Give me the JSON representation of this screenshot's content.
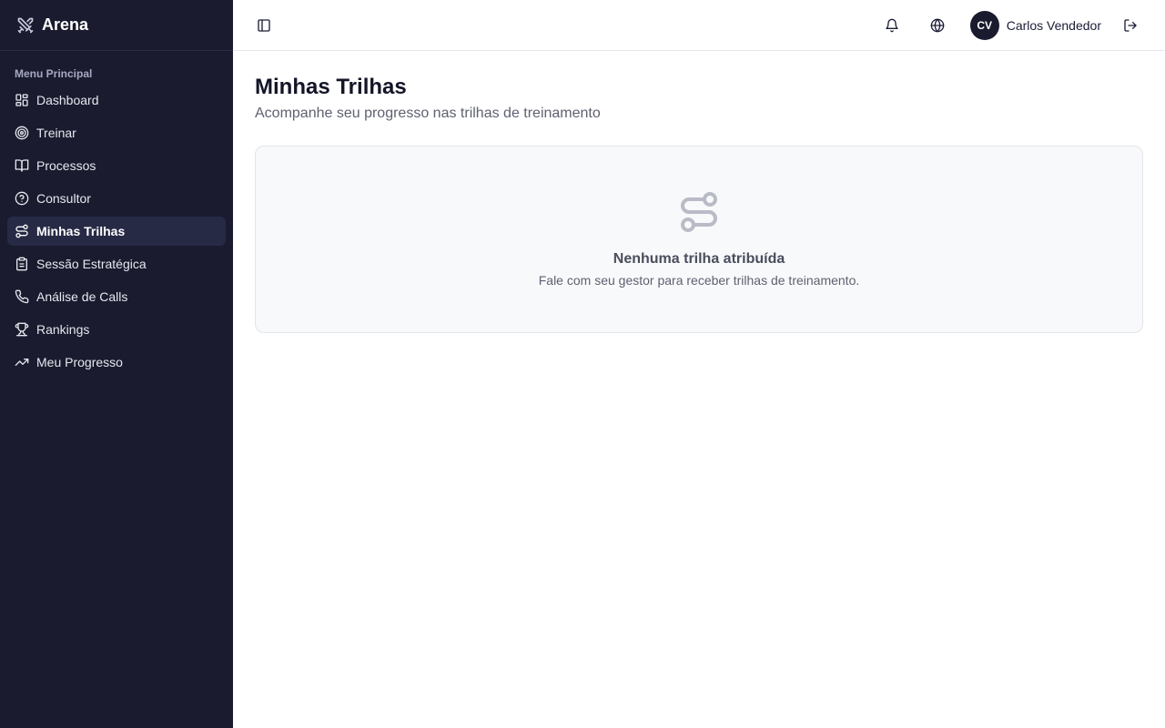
{
  "brand": {
    "name": "Arena",
    "icon": "crossed-swords-icon"
  },
  "sidebar": {
    "group_label": "Menu Principal",
    "items": [
      {
        "label": "Dashboard",
        "icon": "grid-icon",
        "active": false
      },
      {
        "label": "Treinar",
        "icon": "target-icon",
        "active": false
      },
      {
        "label": "Processos",
        "icon": "book-icon",
        "active": false
      },
      {
        "label": "Consultor",
        "icon": "help-circle-icon",
        "active": false
      },
      {
        "label": "Minhas Trilhas",
        "icon": "route-icon",
        "active": true
      },
      {
        "label": "Sessão Estratégica",
        "icon": "clipboard-icon",
        "active": false
      },
      {
        "label": "Análise de Calls",
        "icon": "phone-icon",
        "active": false
      },
      {
        "label": "Rankings",
        "icon": "trophy-icon",
        "active": false
      },
      {
        "label": "Meu Progresso",
        "icon": "trending-up-icon",
        "active": false
      }
    ]
  },
  "header": {
    "user": {
      "initials": "CV",
      "name": "Carlos Vendedor"
    }
  },
  "main": {
    "title": "Minhas Trilhas",
    "subtitle": "Acompanhe seu progresso nas trilhas de treinamento",
    "empty_state": {
      "icon": "route-icon",
      "title": "Nenhuma trilha atribuída",
      "text": "Fale com seu gestor para receber trilhas de treinamento."
    }
  },
  "colors": {
    "sidebar_bg": "#1a1b2e",
    "active_item_bg": "#272a45",
    "card_bg": "#f8f9fb"
  }
}
